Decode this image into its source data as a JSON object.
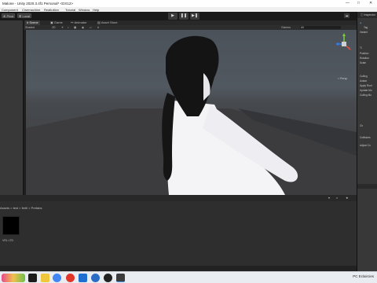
{
  "window": {
    "title": "Malone - Unity 2020.3.4f1 Personal* <DX12>"
  },
  "menu": {
    "items": [
      "Component",
      "Cinemachine",
      "Realtuition",
      "Tutorial",
      "Window",
      "Help"
    ]
  },
  "toolbar": {
    "pivot_label": "Pivot",
    "local_label": "Local"
  },
  "scene_tabs": {
    "scene": "Scene",
    "game": "Game",
    "animator": "Animator",
    "asset_store": "Asset Store"
  },
  "scene_toolbar": {
    "shading_mode": "Shaded",
    "mode_2d": "2D",
    "gizmos": "Gizmos",
    "search_placeholder": "All"
  },
  "gizmo": {
    "projection": "< Persp"
  },
  "inspector": {
    "tab_label": "Inspector",
    "tag_label": "Tag",
    "variant_label": "Variant",
    "rows": [
      "Ti",
      "Position",
      "Rotation",
      "Scale",
      "Culling",
      "Avatar",
      "Apply Root",
      "Update Mo",
      "Culling Mo",
      "Ch",
      "Collisions",
      "Adjust Co"
    ]
  },
  "project": {
    "breadcrumb": "Assets > test > fertil > Prefabs",
    "prefab_name": "VRL LTD"
  },
  "taskbar": {
    "tray_text": "PC  Eclaircies"
  },
  "colors": {
    "unity_dark": "#383838",
    "viewport_sky": "#4b525a",
    "accent_blue": "#2f6fbd"
  }
}
